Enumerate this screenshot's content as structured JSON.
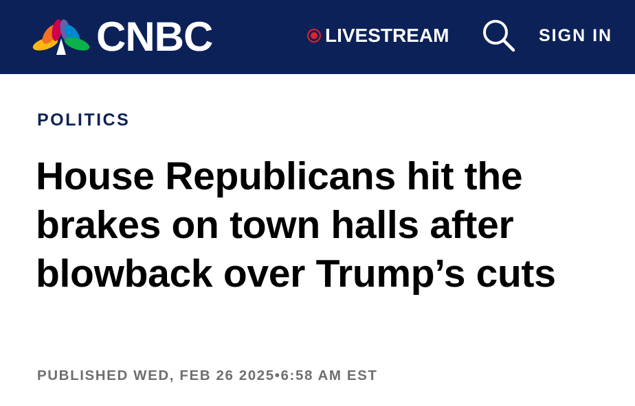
{
  "header": {
    "brand": "CNBC",
    "live_label": "LIVESTREAM",
    "signin_label": "SIGN IN",
    "search_icon": "search-icon",
    "live_icon": "live-dot-icon",
    "background_color": "#0c2158",
    "live_color": "#e4202b"
  },
  "article": {
    "category": "POLITICS",
    "headline": "House Republicans hit the brakes on town halls after blowback over Trump’s cuts",
    "published": "PUBLISHED WED, FEB 26 2025•6:58 AM EST"
  },
  "colors": {
    "navy": "#0c2158",
    "meta_gray": "#6f6f6f"
  }
}
